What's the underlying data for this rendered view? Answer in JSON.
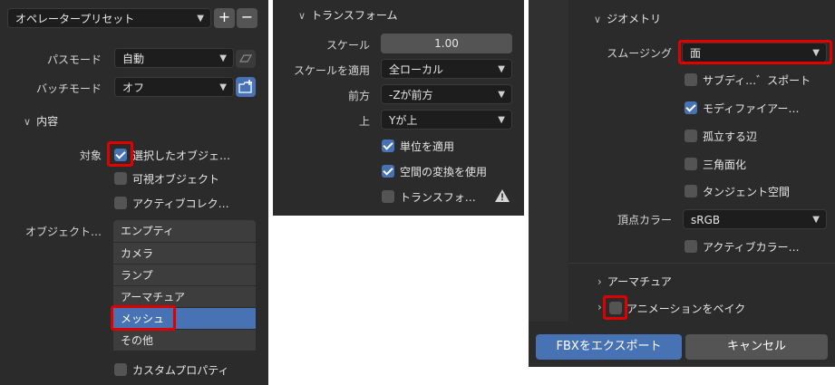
{
  "left": {
    "preset_label": "オペレータープリセット",
    "add_label": "+",
    "remove_label": "−",
    "path_mode_label": "パスモード",
    "path_mode_value": "自動",
    "batch_mode_label": "バッチモード",
    "batch_mode_value": "オフ",
    "include_header": "内容",
    "target_label": "対象",
    "opt_selected": "選択したオブジェ…",
    "opt_visible": "可視オブジェクト",
    "opt_active_collection": "アクティブコレク…",
    "object_types_label": "オブジェクト…",
    "object_types": [
      "エンプティ",
      "カメラ",
      "ランプ",
      "アーマチュア",
      "メッシュ",
      "その他"
    ],
    "custom_props": "カスタムプロパティ"
  },
  "middle": {
    "header": "トランスフォーム",
    "scale_label": "スケール",
    "scale_value": "1.00",
    "apply_scale_label": "スケールを適用",
    "apply_scale_value": "全ローカル",
    "forward_label": "前方",
    "forward_value": "-Zが前方",
    "up_label": "上",
    "up_value": "Yが上",
    "apply_unit": "単位を適用",
    "use_space_transform": "空間の変換を使用",
    "apply_transform": "トランスフォ…"
  },
  "right": {
    "header": "ジオメトリ",
    "smoothing_label": "スムージング",
    "smoothing_value": "面",
    "subdiv_export": "サブディ…゛スポート",
    "apply_modifiers": "モディファイアー…",
    "loose_edges": "孤立する辺",
    "triangulate": "三角面化",
    "tangent_space": "タンジェント空間",
    "vertex_color_label": "頂点カラー",
    "vertex_color_value": "sRGB",
    "active_color": "アクティブカラー…",
    "armature_header": "アーマチュア",
    "bake_anim": "アニメーションをベイク",
    "export_button": "FBXをエクスポート",
    "cancel_button": "キャンセル"
  },
  "colors": {
    "panel_bg": "#2b2b2b",
    "field_bg": "#1d1d1d",
    "checkbox_off": "#545454",
    "accent": "#4772b3",
    "highlight_red": "#e00000"
  }
}
